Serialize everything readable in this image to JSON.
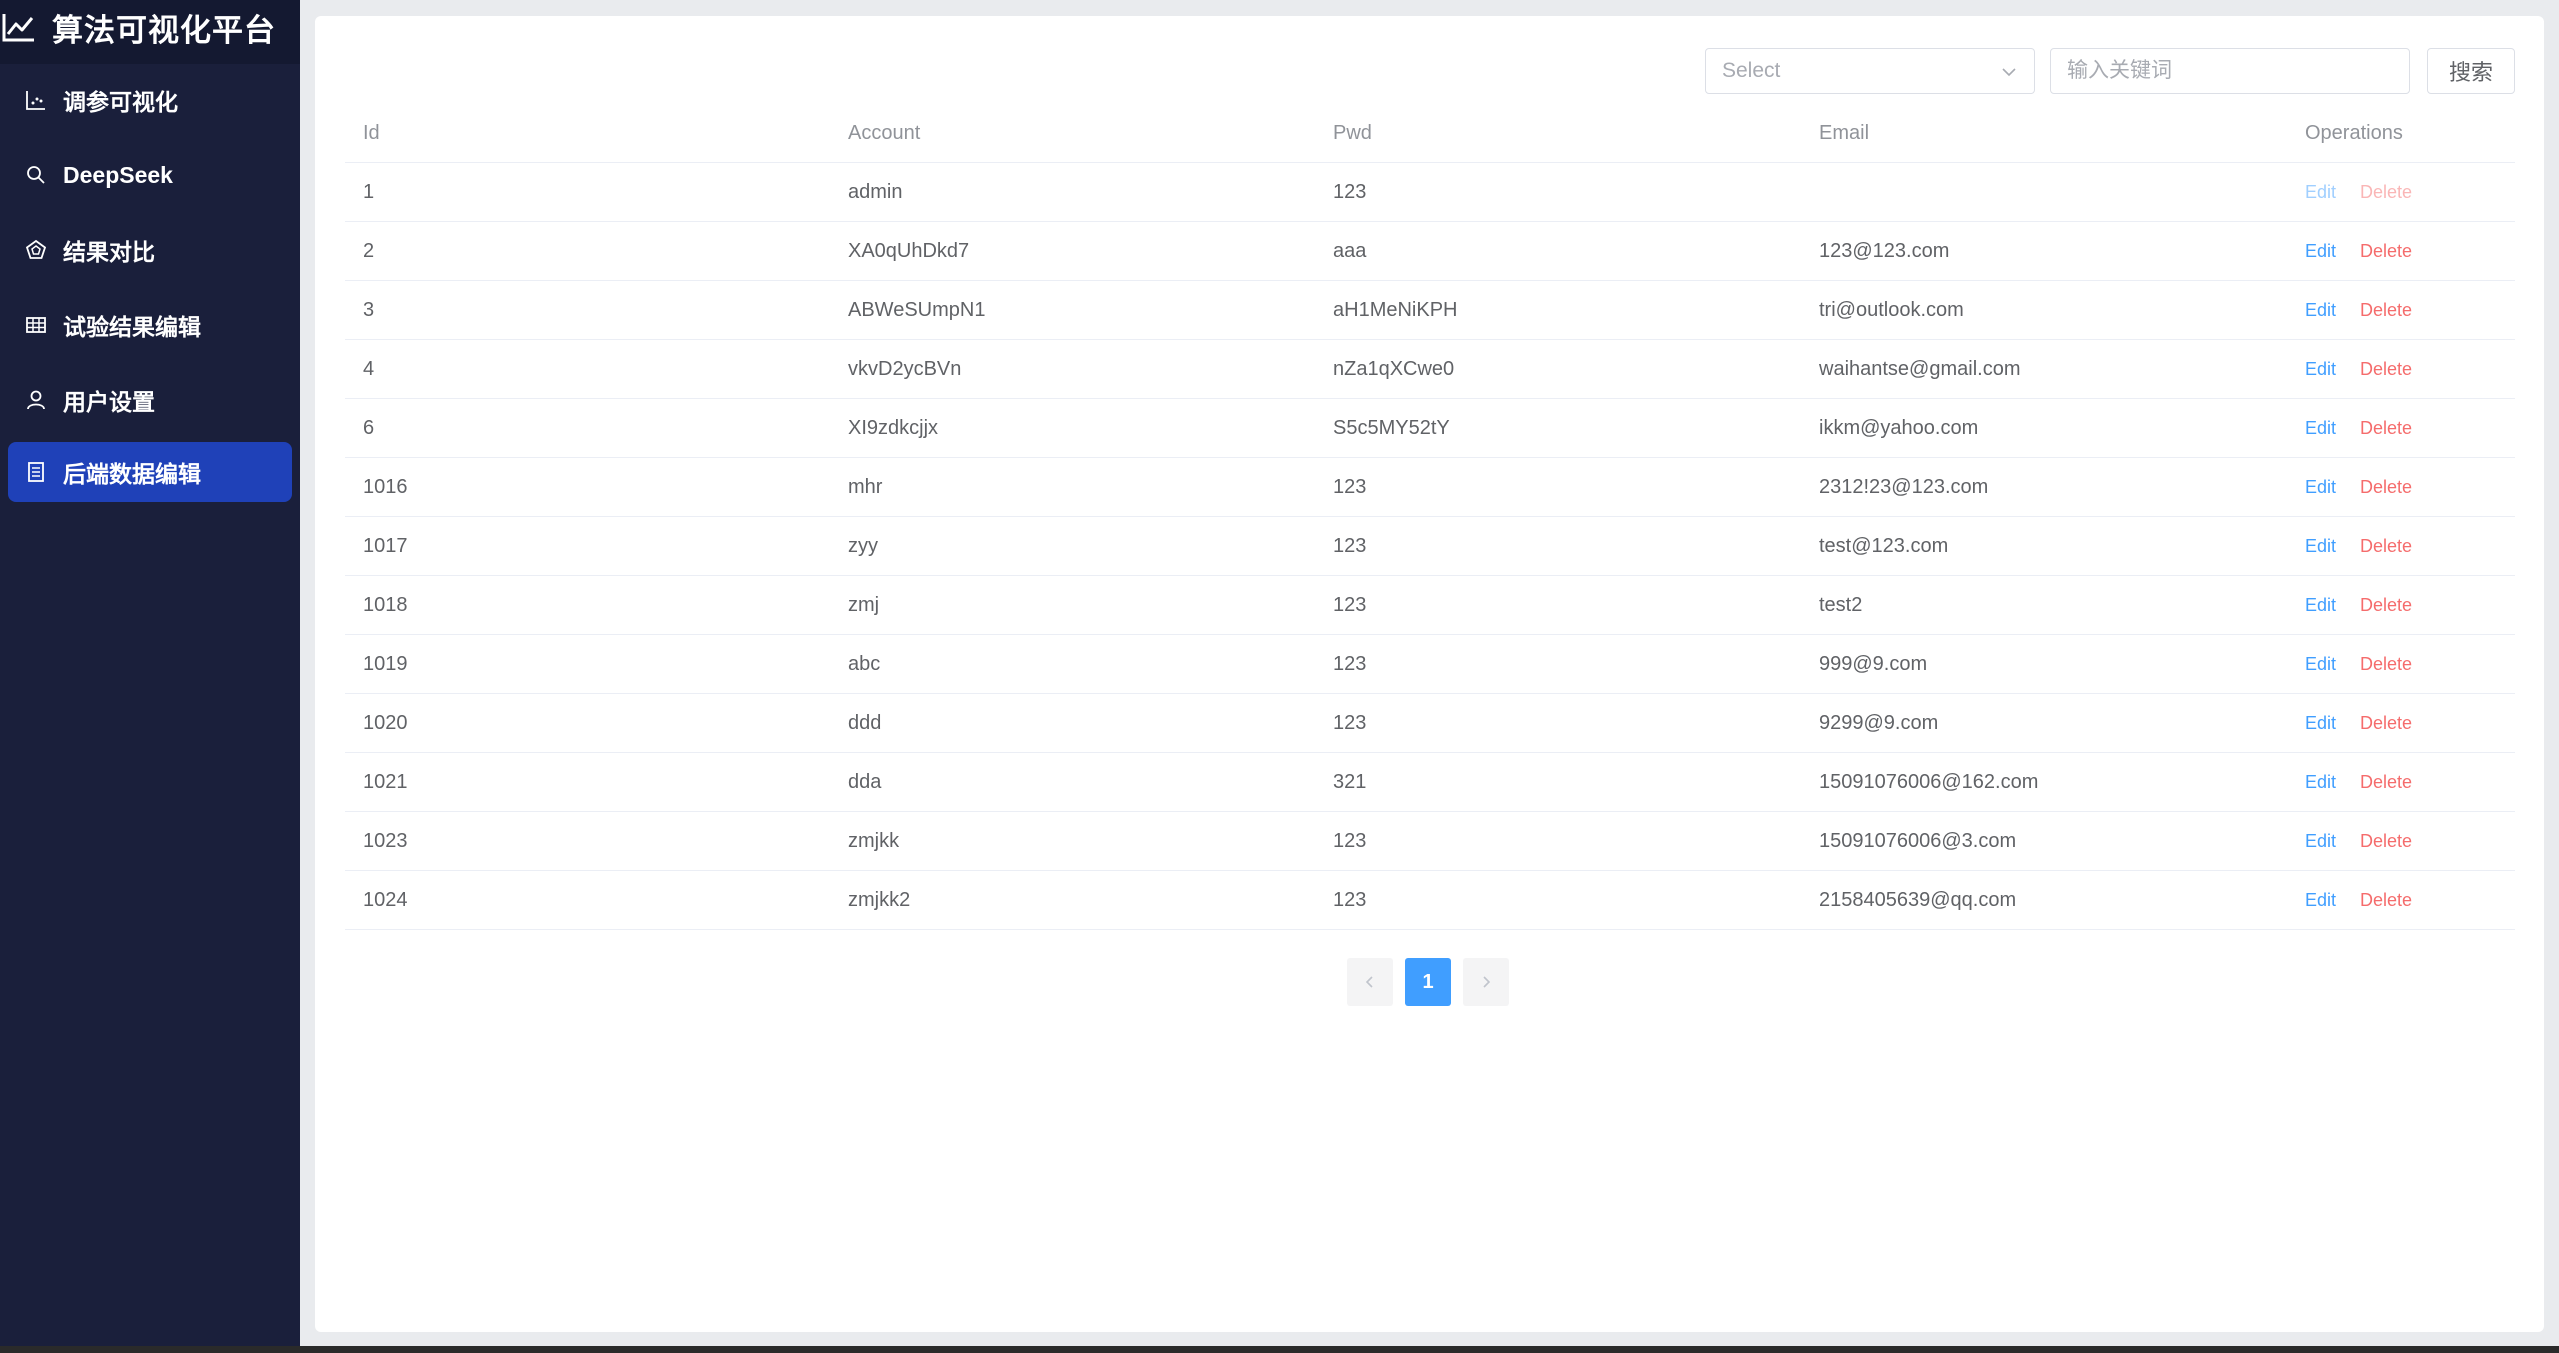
{
  "app": {
    "title": "算法可视化平台"
  },
  "sidebar": {
    "items": [
      {
        "label": "调参可视化",
        "icon": "chart-icon",
        "active": false
      },
      {
        "label": "DeepSeek",
        "icon": "search-icon",
        "active": false
      },
      {
        "label": "结果对比",
        "icon": "radar-icon",
        "active": false
      },
      {
        "label": "试验结果编辑",
        "icon": "grid-icon",
        "active": false
      },
      {
        "label": "用户设置",
        "icon": "user-icon",
        "active": false
      },
      {
        "label": "后端数据编辑",
        "icon": "document-icon",
        "active": true
      }
    ]
  },
  "toolbar": {
    "select_placeholder": "Select",
    "input_placeholder": "输入关键词",
    "search_label": "搜索"
  },
  "table": {
    "columns": [
      "Id",
      "Account",
      "Pwd",
      "Email",
      "Operations"
    ],
    "rows": [
      {
        "id": "1",
        "account": "admin",
        "pwd": "123",
        "email": ""
      },
      {
        "id": "2",
        "account": "XA0qUhDkd7",
        "pwd": "aaa",
        "email": "123@123.com"
      },
      {
        "id": "3",
        "account": "ABWeSUmpN1",
        "pwd": "aH1MeNiKPH",
        "email": "tri@outlook.com"
      },
      {
        "id": "4",
        "account": "vkvD2ycBVn",
        "pwd": "nZa1qXCwe0",
        "email": "waihantse@gmail.com"
      },
      {
        "id": "6",
        "account": "XI9zdkcjjx",
        "pwd": "S5c5MY52tY",
        "email": "ikkm@yahoo.com"
      },
      {
        "id": "1016",
        "account": "mhr",
        "pwd": "123",
        "email": "2312!23@123.com"
      },
      {
        "id": "1017",
        "account": "zyy",
        "pwd": "123",
        "email": "test@123.com"
      },
      {
        "id": "1018",
        "account": "zmj",
        "pwd": "123",
        "email": "test2"
      },
      {
        "id": "1019",
        "account": "abc",
        "pwd": "123",
        "email": "999@9.com"
      },
      {
        "id": "1020",
        "account": "ddd",
        "pwd": "123",
        "email": "9299@9.com"
      },
      {
        "id": "1021",
        "account": "dda",
        "pwd": "321",
        "email": "15091076006@162.com"
      },
      {
        "id": "1023",
        "account": "zmjkk",
        "pwd": "123",
        "email": "15091076006@3.com"
      },
      {
        "id": "1024",
        "account": "zmjkk2",
        "pwd": "123",
        "email": "2158405639@qq.com"
      }
    ],
    "edit_label": "Edit",
    "delete_label": "Delete"
  },
  "pagination": {
    "current_page": "1",
    "prev_icon": "chevron-left-icon",
    "next_icon": "chevron-right-icon"
  },
  "colors": {
    "sidebar_bg": "#1a1f3b",
    "active_item": "#1f41b8",
    "primary": "#409eff",
    "danger": "#f56c6c"
  }
}
